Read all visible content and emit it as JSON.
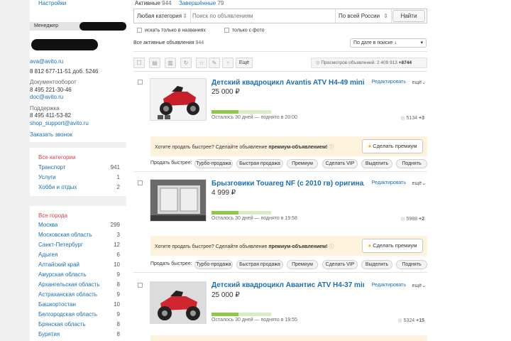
{
  "sidebar": {
    "settings": "Настройки",
    "manager_label": "Менеджер",
    "email": "ava@avito.ru",
    "phone": "8 812 677-11-51 доб. 5246",
    "docflow_label": "Документооборот",
    "docflow_phone": "8 495 221-30-46",
    "docflow_email": "doc@avito.ru",
    "support_label": "Поддержка",
    "support_phone": "8 495 411-53-82",
    "support_email": "shop_support@avito.ru",
    "callback": "Заказать звонок",
    "categories_title": "Все категории",
    "categories": [
      {
        "label": "Транспорт",
        "count": "941"
      },
      {
        "label": "Услуги",
        "count": "1"
      },
      {
        "label": "Хобби и отдых",
        "count": "2"
      }
    ],
    "cities_title": "Все города",
    "cities": [
      {
        "label": "Москва",
        "count": "299"
      },
      {
        "label": "Московская область",
        "count": "3"
      },
      {
        "label": "Санкт-Петербург",
        "count": "12"
      },
      {
        "label": "Адыгея",
        "count": "6"
      },
      {
        "label": "Алтайский край",
        "count": "10"
      },
      {
        "label": "Амурская область",
        "count": "9"
      },
      {
        "label": "Архангельская область",
        "count": "8"
      },
      {
        "label": "Астраханская область",
        "count": "9"
      },
      {
        "label": "Башкортостан",
        "count": "10"
      },
      {
        "label": "Белгородская область",
        "count": "9"
      },
      {
        "label": "Брянская область",
        "count": "8"
      },
      {
        "label": "Бурятия",
        "count": "8"
      }
    ]
  },
  "tabs": {
    "active_label": "Активные",
    "active_count": "944",
    "finished_label": "Завершённые",
    "finished_count": "79"
  },
  "search": {
    "category": "Любая категория",
    "placeholder": "Поиск по объявлениям",
    "region": "По всей России",
    "button": "Найти"
  },
  "filters": {
    "titles_only": "искать только в названиях",
    "with_photo": "только с фото"
  },
  "list_header": {
    "label": "Все активные объявления",
    "count": "944",
    "sort": "По дате в поиске ↓"
  },
  "toolbar": {
    "more": "Ещё",
    "views_label": "Просмотров объявлений:",
    "views_value": "2 409 913",
    "views_delta": "+8744"
  },
  "actions": {
    "edit": "Редактировать",
    "more": "ещё"
  },
  "premium": {
    "text_before": "Хотите продать быстрее? Сделайте объявление ",
    "text_bold": "премиум-объявлением!",
    "button": "Сделать премиум"
  },
  "quick_sell": {
    "label": "Продать быстрее:",
    "buttons": [
      "Турбо-продажа",
      "Быстрая продажа",
      "Премиум",
      "Сделать VIP",
      "Выделить",
      "Поднять"
    ]
  },
  "listings": [
    {
      "title": "Детский квадроцикл Avantis ATV H4-49 mini 49 с",
      "price": "25 000 ₽",
      "status": "Осталось 30 дней — поднято в 20:00",
      "views": "5134",
      "delta": "+3",
      "progress": 0.45
    },
    {
      "title": "Брызговики Touareg NF (с 2010 гв) оригинал",
      "price": "4 999 ₽",
      "status": "Осталось 30 дней — поднято в 19:58",
      "views": "5988",
      "delta": "+2",
      "progress": 0.45
    },
    {
      "title": "Детский квадроцикл Авантис ATV H4-37 mini",
      "price": "25 000 ₽",
      "status": "Осталось 30 дней — поднято в 19:55",
      "views": "5324",
      "delta": "+15",
      "progress": 0.45
    }
  ],
  "colors": {
    "link": "#1a6fb3",
    "category_title": "#d6424a",
    "progress": "#8dc84b",
    "premium_bg": "#fdf2dc"
  }
}
